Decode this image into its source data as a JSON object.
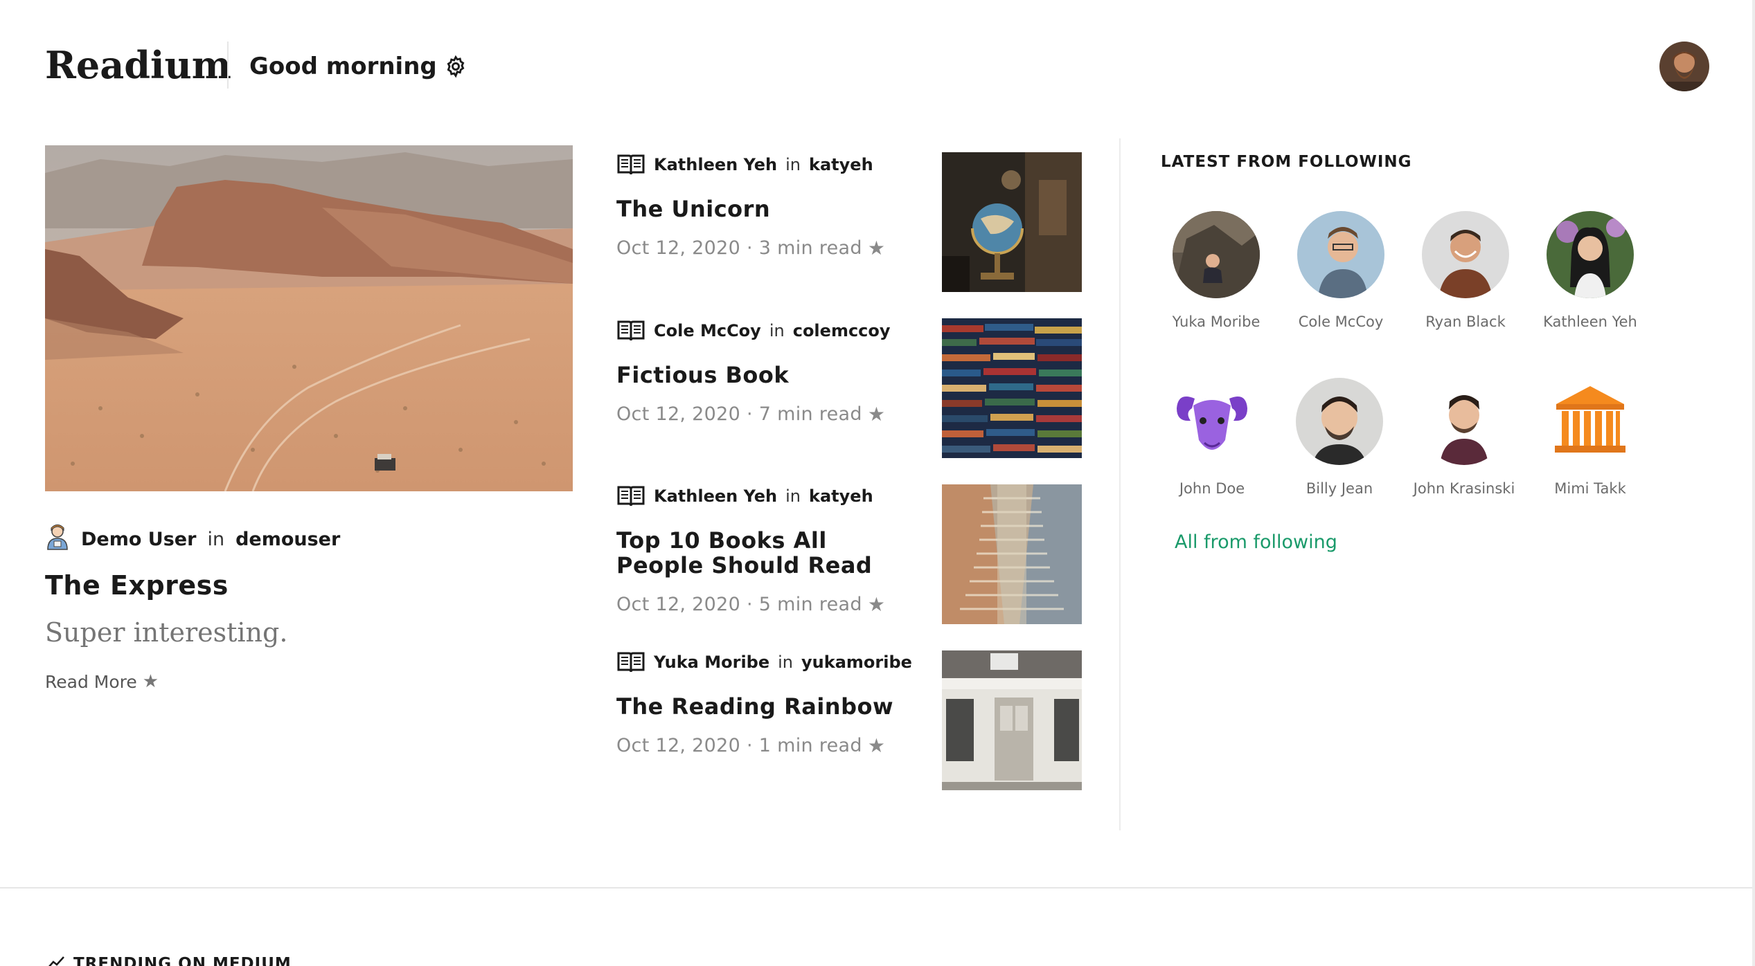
{
  "header": {
    "logo": "Readium",
    "greeting": "Good morning",
    "settings_icon": "gear-icon",
    "avatar_icon": "user-avatar"
  },
  "featured": {
    "author": "Demo User",
    "in": "in",
    "publication": "demouser",
    "title": "The Express",
    "subtitle": "Super interesting.",
    "read_more": "Read More",
    "star": "★"
  },
  "stories": [
    {
      "author": "Kathleen Yeh",
      "in": "in",
      "publication": "katyeh",
      "title": "The Unicorn",
      "date": "Oct 12, 2020 · 3 min read",
      "star": "★"
    },
    {
      "author": "Cole McCoy",
      "in": "in",
      "publication": "colemccoy",
      "title": "Fictious Book",
      "date": "Oct 12, 2020 · 7 min read",
      "star": "★"
    },
    {
      "author": "Kathleen Yeh",
      "in": "in",
      "publication": "katyeh",
      "title": "Top 10 Books All People Should Read",
      "date": "Oct 12, 2020 · 5 min read",
      "star": "★"
    },
    {
      "author": "Yuka Moribe",
      "in": "in",
      "publication": "yukamoribe",
      "title": "The Reading Rainbow",
      "date": "Oct 12, 2020 · 1 min read",
      "star": "★"
    }
  ],
  "following": {
    "title": "LATEST FROM FOLLOWING",
    "people": [
      {
        "name": "Yuka Moribe"
      },
      {
        "name": "Cole McCoy"
      },
      {
        "name": "Ryan Black"
      },
      {
        "name": "Kathleen Yeh"
      },
      {
        "name": "John Doe"
      },
      {
        "name": "Billy Jean"
      },
      {
        "name": "John Krasinski"
      },
      {
        "name": "Mimi Takk"
      }
    ],
    "all_link": "All from following"
  },
  "trending": {
    "title": "TRENDING ON MEDIUM"
  },
  "colors": {
    "accent": "#1a9a6a",
    "muted": "#8a8a8a"
  }
}
